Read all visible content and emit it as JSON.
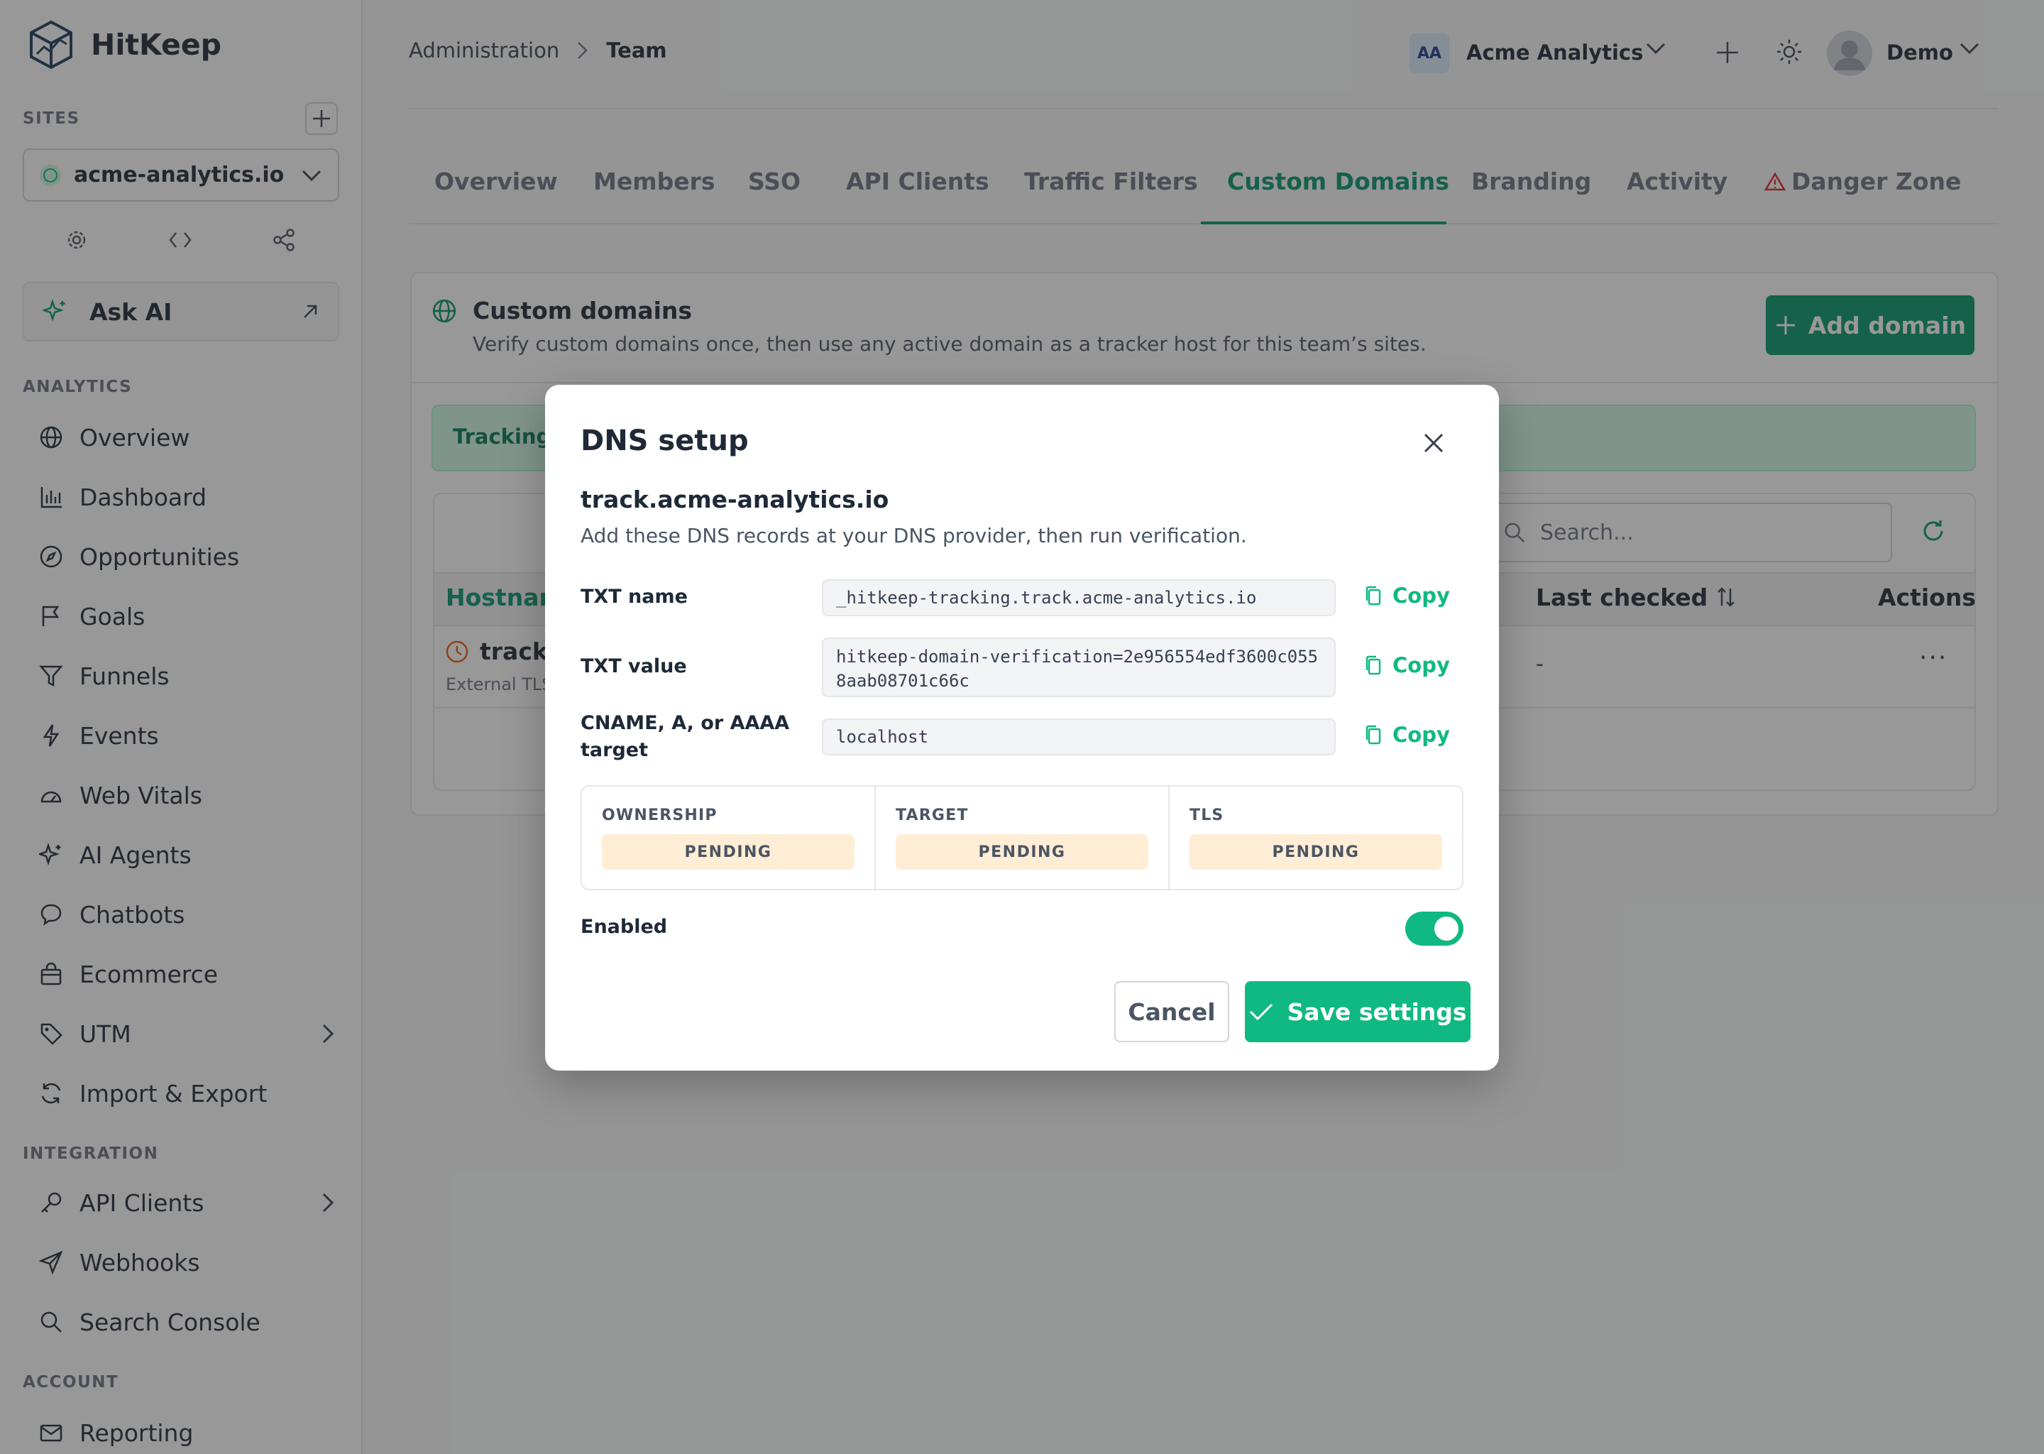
{
  "app": {
    "name": "HitKeep"
  },
  "sidebar": {
    "sites_label": "SITES",
    "site_select": "acme-analytics.io",
    "ask_ai": "Ask AI",
    "analytics_label": "ANALYTICS",
    "analytics_items": [
      {
        "label": "Overview",
        "icon": "globe-icon"
      },
      {
        "label": "Dashboard",
        "icon": "bar-chart-icon"
      },
      {
        "label": "Opportunities",
        "icon": "compass-icon"
      },
      {
        "label": "Goals",
        "icon": "flag-icon"
      },
      {
        "label": "Funnels",
        "icon": "filter-icon"
      },
      {
        "label": "Events",
        "icon": "lightning-icon"
      },
      {
        "label": "Web Vitals",
        "icon": "gauge-icon"
      },
      {
        "label": "AI Agents",
        "icon": "sparkles-icon"
      },
      {
        "label": "Chatbots",
        "icon": "chat-icon"
      },
      {
        "label": "Ecommerce",
        "icon": "shopping-bag-icon"
      },
      {
        "label": "UTM",
        "icon": "tag-icon"
      },
      {
        "label": "Import & Export",
        "icon": "refresh-icon"
      }
    ],
    "integration_label": "INTEGRATION",
    "integration_items": [
      {
        "label": "API Clients",
        "icon": "key-icon"
      },
      {
        "label": "Webhooks",
        "icon": "send-icon"
      },
      {
        "label": "Search Console",
        "icon": "search-icon"
      }
    ],
    "account_label": "ACCOUNT",
    "account_items": [
      {
        "label": "Reporting",
        "icon": "mail-icon"
      }
    ]
  },
  "header": {
    "breadcrumb": [
      "Administration",
      "Team"
    ],
    "team_initials": "AA",
    "team_name": "Acme Analytics",
    "user_name": "Demo"
  },
  "tabs": [
    "Overview",
    "Members",
    "SSO",
    "API Clients",
    "Traffic Filters",
    "Custom Domains",
    "Branding",
    "Activity",
    "Danger Zone"
  ],
  "active_tab": "Custom Domains",
  "card": {
    "title": "Custom domains",
    "subtitle": "Verify custom domains once, then use any active domain as a tracker host for this team’s sites.",
    "add_button": "Add domain",
    "tracking_banner": "Tracking",
    "search_placeholder": "Search...",
    "columns": {
      "hostname": "Hostnam",
      "last_checked": "Last checked",
      "actions": "Actions"
    },
    "row": {
      "host": "track.",
      "sub": "External TLS",
      "last_checked": "-",
      "actions": "···"
    }
  },
  "modal": {
    "title": "DNS setup",
    "hostname": "track.acme-analytics.io",
    "description": "Add these DNS records at your DNS provider, then run verification.",
    "records": [
      {
        "label": "TXT name",
        "value": "_hitkeep-tracking.track.acme-analytics.io",
        "copy": "Copy"
      },
      {
        "label": "TXT value",
        "value": "hitkeep-domain-verification=2e956554edf3600c0558aab08701c66c",
        "copy": "Copy"
      },
      {
        "label": "CNAME, A, or AAAA target",
        "value": "localhost",
        "copy": "Copy"
      }
    ],
    "statuses": [
      {
        "label": "OWNERSHIP",
        "value": "PENDING"
      },
      {
        "label": "TARGET",
        "value": "PENDING"
      },
      {
        "label": "TLS",
        "value": "PENDING"
      }
    ],
    "enabled_label": "Enabled",
    "enabled": true,
    "cancel": "Cancel",
    "save": "Save settings"
  },
  "colors": {
    "brand": "#10b981",
    "brand_dark": "#059669",
    "pending_bg": "#ffedd5"
  }
}
